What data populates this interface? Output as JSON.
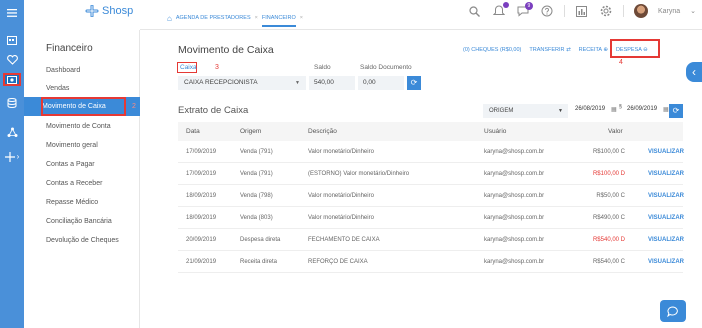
{
  "brand": {
    "logo_text": "Shosp"
  },
  "rail": {
    "icons": [
      "menu-icon",
      "calendar-icon",
      "heart-icon",
      "cash-icon",
      "database-icon",
      "network-icon",
      "plus-icon"
    ],
    "expand_glyph": "›"
  },
  "breadcrumb": {
    "items": [
      "AGENDA DE PRESTADORES",
      "FINANCEIRO"
    ],
    "close_glyph": "×"
  },
  "topbar": {
    "notification_badge": "9",
    "user_name": "Karyna"
  },
  "sidebar": {
    "title": "Financeiro",
    "items": [
      "Dashboard",
      "Vendas",
      "Movimento de Caixa",
      "Movimento de Conta",
      "Movimento geral",
      "Contas a Pagar",
      "Contas a Receber",
      "Repasse Médico",
      "Conciliação Bancária",
      "Devolução de Cheques"
    ],
    "active_index": 2,
    "marker": "2"
  },
  "page": {
    "title": "Movimento de Caixa",
    "actions": {
      "cheques": "(0) CHEQUES (R$0,00)",
      "transferir": "TRANSFERIR",
      "receita": "RECEITA",
      "despesa": "DESPESA"
    },
    "marker_despesa": "4",
    "caixa_label": "Caixa",
    "marker_caixa": "3",
    "saldo_label": "Saldo",
    "saldo_documento_label": "Saldo Documento",
    "caixa_value": "CAIXA RECEPCIONISTA",
    "saldo_value": "540,00",
    "saldo_documento_value": "0,00"
  },
  "extrato": {
    "title": "Extrato de Caixa",
    "origem_value": "ORIGEM",
    "date_from": "26/08/2019",
    "date_to": "26/09/2019",
    "columns": [
      "Data",
      "Origem",
      "Descrição",
      "Usuário",
      "Valor"
    ],
    "rows": [
      {
        "data": "17/09/2019",
        "origem": "Venda (791)",
        "descricao": "Valor monetário/Dinheiro",
        "usuario": "karyna@shosp.com.br",
        "valor": "R$100,00 C",
        "negative": false,
        "action": "VISUALIZAR"
      },
      {
        "data": "17/09/2019",
        "origem": "Venda (791)",
        "descricao": "(ESTORNO) Valor monetário/Dinheiro",
        "usuario": "karyna@shosp.com.br",
        "valor": "R$100,00 D",
        "negative": true,
        "action": "VISUALIZAR"
      },
      {
        "data": "18/09/2019",
        "origem": "Venda (798)",
        "descricao": "Valor monetário/Dinheiro",
        "usuario": "karyna@shosp.com.br",
        "valor": "R$50,00 C",
        "negative": false,
        "action": "VISUALIZAR"
      },
      {
        "data": "18/09/2019",
        "origem": "Venda (803)",
        "descricao": "Valor monetário/Dinheiro",
        "usuario": "karyna@shosp.com.br",
        "valor": "R$490,00 C",
        "negative": false,
        "action": "VISUALIZAR"
      },
      {
        "data": "20/09/2019",
        "origem": "Despesa direta",
        "descricao": "FECHAMENTO DE CAIXA",
        "usuario": "karyna@shosp.com.br",
        "valor": "R$540,00 D",
        "negative": true,
        "action": "VISUALIZAR"
      },
      {
        "data": "21/09/2019",
        "origem": "Receita direta",
        "descricao": "REFORÇO DE CAIXA",
        "usuario": "karyna@shosp.com.br",
        "valor": "R$540,00 C",
        "negative": false,
        "action": "VISUALIZAR"
      }
    ]
  },
  "colors": {
    "primary": "#3b8ad8",
    "rail": "#4a90d9",
    "danger": "#e53935",
    "badge": "#7b3fbf"
  }
}
